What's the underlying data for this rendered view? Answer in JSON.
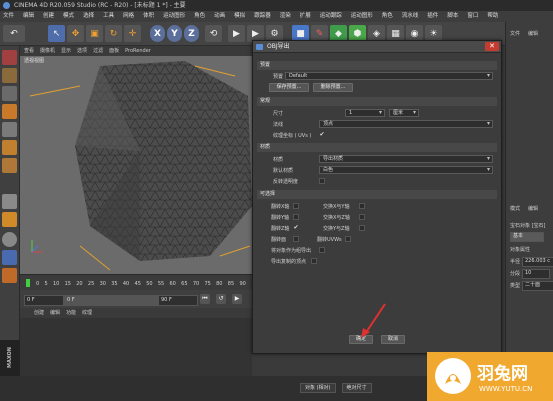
{
  "window": {
    "title": "CINEMA 4D R20.059 Studio (RC - R20) - [未标题 1 *] - 主要"
  },
  "menubar": [
    "文件",
    "编辑",
    "创建",
    "模式",
    "选择",
    "工具",
    "网格",
    "体积",
    "运动图形",
    "角色",
    "动画",
    "模拟",
    "跟踪器",
    "渲染",
    "扩展",
    "运动跟踪",
    "运动图形",
    "角色",
    "流水线",
    "插件",
    "脚本",
    "窗口",
    "帮助"
  ],
  "toolbar": {
    "x": "X",
    "y": "Y",
    "z": "Z"
  },
  "viewport": {
    "menu": [
      "查看",
      "摄像机",
      "显示",
      "选项",
      "过滤",
      "面板",
      "ProRender"
    ],
    "label": "透视视图"
  },
  "timeline": {
    "ticks": [
      "0",
      "5",
      "10",
      "15",
      "20",
      "25",
      "30",
      "35",
      "40",
      "45",
      "50",
      "55",
      "60",
      "65",
      "70",
      "75",
      "80",
      "85",
      "90"
    ],
    "start": "0 F",
    "range_start": "0 F",
    "range_end": "90 F",
    "end": "90 F"
  },
  "material_menu": [
    "创建",
    "编辑",
    "功能",
    "纹理"
  ],
  "brand_strip": "MAXON CINEMA 4D",
  "right_panel": {
    "top": [
      "文件",
      "编辑"
    ],
    "mode_menu": [
      "模式",
      "编辑"
    ],
    "obj_label": "宝石对象 [宝石]",
    "basic": "基本",
    "props_head": "对象属性",
    "radius_label": "半径",
    "radius_value": "226.003 c",
    "segments_label": "分段",
    "segments_value": "10",
    "type_label": "类型",
    "type_value": "二十面"
  },
  "coord_bar": {
    "mode": "对象 (相对)",
    "size": "绝对尺寸"
  },
  "dialog": {
    "title": "OBJ导出",
    "close": "✕",
    "sections": {
      "preset": "预置",
      "general": "常规",
      "material": "材质",
      "optional": "可选择"
    },
    "preset_label": "预置",
    "preset_value": "Default",
    "save_preset": "保存预置...",
    "delete_preset": "删除预置...",
    "size_label": "尺寸",
    "size_value": "1",
    "unit_value": "厘米",
    "face_label": "法线",
    "face_value": "顶点",
    "uv_label": "纹理坐标 ( UVs )",
    "uv_checked": "✔",
    "mat_label": "材质",
    "mat_value": "导出材质",
    "default_mat_label": "默认材质",
    "default_mat_value": "白色",
    "transparency_label": "反转透明度",
    "options": [
      {
        "left": "翻转X轴",
        "right": "交换X与Y轴"
      },
      {
        "left": "翻转Y轴",
        "right": "交换X与Z轴"
      },
      {
        "left": "翻转Z轴",
        "right": "交换Y与Z轴"
      }
    ],
    "flip_faces": "翻转面",
    "flip_uvws": "翻转UVWs",
    "triangulate": "将对象作为组导出",
    "export_instances": "导出复制的顶点",
    "ok": "确定",
    "cancel": "取消"
  },
  "watermark": {
    "title": "羽兔网",
    "url": "WWW.YUTU.CN"
  }
}
